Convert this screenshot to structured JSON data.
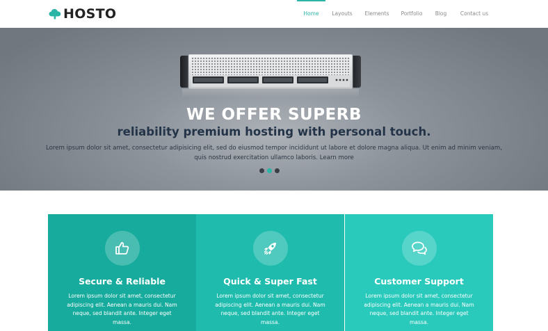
{
  "header": {
    "logo_text": "HOSTO",
    "logo_icon": "cloud-tree-icon",
    "nav": [
      {
        "label": "Home",
        "active": true
      },
      {
        "label": "Layouts",
        "active": false
      },
      {
        "label": "Elements",
        "active": false
      },
      {
        "label": "Portfolio",
        "active": false
      },
      {
        "label": "Blog",
        "active": false
      },
      {
        "label": "Contact us",
        "active": false
      }
    ]
  },
  "hero": {
    "title": "WE OFFER SUPERB",
    "subtitle": "reliability premium hosting with personal touch.",
    "text": "Lorem ipsum dolor sit amet, consectetur adipisicing elit, sed do eiusmod tempor incididunt ut labore et dolore magna aliqua. Ut enim ad minim veniam, quis nostrud exercitation ullamco laboris.",
    "more_link": "Learn more",
    "slider_dots": 3,
    "active_dot": 2
  },
  "features": [
    {
      "icon": "thumbs-up-icon",
      "title": "Secure & Reliable",
      "text": "Lorem ipsum dolor sit amet, consectetur adipiscing elit. Aenean a mauris dui. Nam neque, sed blandit ante. Integer eget massa."
    },
    {
      "icon": "rocket-icon",
      "title": "Quick & Super Fast",
      "text": "Lorem ipsum dolor sit amet, consectetur adipiscing elit. Aenean a mauris dui. Nam neque, sed blandit ante. Integer eget massa."
    },
    {
      "icon": "chat-bubbles-icon",
      "title": "Customer Support",
      "text": "Lorem ipsum dolor sit amet, consectetur adipiscing elit. Aenean a mauris dui. Nam neque, sed blandit ante. Integer eget massa."
    }
  ],
  "colors": {
    "accent": "#2bb5a7",
    "feature_1_bg": "#17ab9d",
    "feature_2_bg": "#1fbcae",
    "feature_3_bg": "#29c9bb",
    "hero_title": "#ffffff",
    "hero_subtitle": "#243448"
  }
}
